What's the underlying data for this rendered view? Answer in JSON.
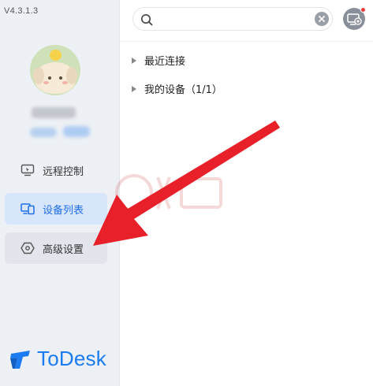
{
  "app": {
    "version": "V4.3.1.3",
    "brand_name": "ToDesk",
    "brand_color": "#1a7cf0"
  },
  "sidebar": {
    "items": [
      {
        "label": "远程控制",
        "icon": "remote-control-icon",
        "active": false
      },
      {
        "label": "设备列表",
        "icon": "device-list-icon",
        "active": true
      },
      {
        "label": "高级设置",
        "icon": "hexagon-settings-icon",
        "active": false
      }
    ]
  },
  "search": {
    "value": "",
    "placeholder": ""
  },
  "device_tree": {
    "groups": [
      {
        "label": "最近连接"
      },
      {
        "label": "我的设备（1/1）"
      }
    ]
  },
  "colors": {
    "accent": "#1e6fe8",
    "active_bg": "#d7e6fb",
    "annotation_arrow": "#e8202a",
    "notification_dot": "#f03b3b"
  }
}
